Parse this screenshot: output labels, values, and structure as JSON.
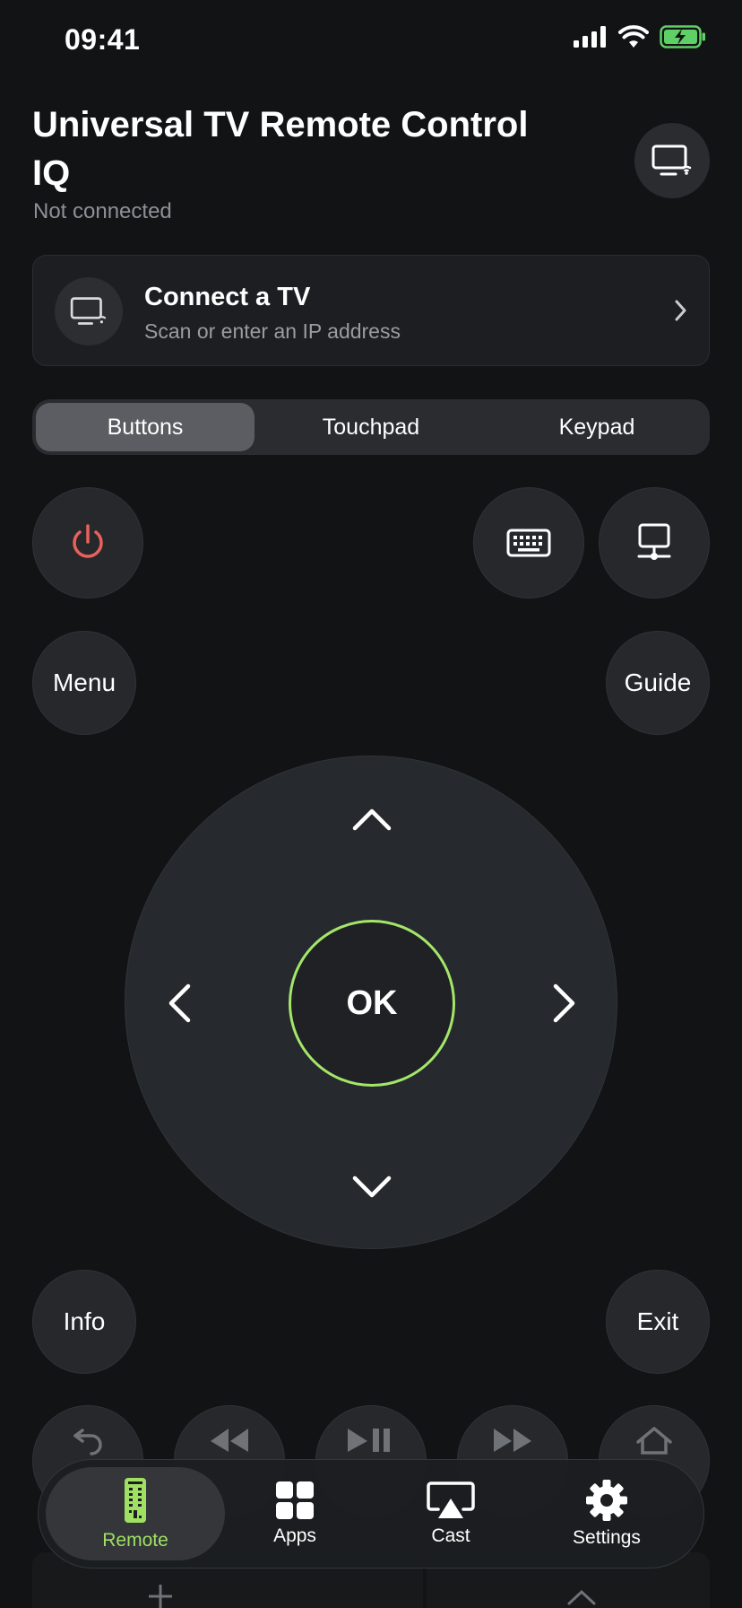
{
  "status_bar": {
    "time": "09:41"
  },
  "header": {
    "title": "Universal TV Remote Control IQ",
    "connection_status": "Not connected"
  },
  "connect_card": {
    "title": "Connect a TV",
    "subtitle": "Scan or enter an IP address"
  },
  "mode_tabs": [
    {
      "label": "Buttons",
      "active": true
    },
    {
      "label": "Touchpad",
      "active": false
    },
    {
      "label": "Keypad",
      "active": false
    }
  ],
  "remote": {
    "menu_label": "Menu",
    "guide_label": "Guide",
    "ok_label": "OK",
    "info_label": "Info",
    "exit_label": "Exit"
  },
  "tab_bar": [
    {
      "label": "Remote",
      "icon": "remote-icon",
      "active": true
    },
    {
      "label": "Apps",
      "icon": "apps-icon",
      "active": false
    },
    {
      "label": "Cast",
      "icon": "cast-icon",
      "active": false
    },
    {
      "label": "Settings",
      "icon": "gear-icon",
      "active": false
    }
  ],
  "colors": {
    "accent": "#a4e66a",
    "power": "#e8615b",
    "background": "#121315",
    "surface": "#26282c"
  }
}
